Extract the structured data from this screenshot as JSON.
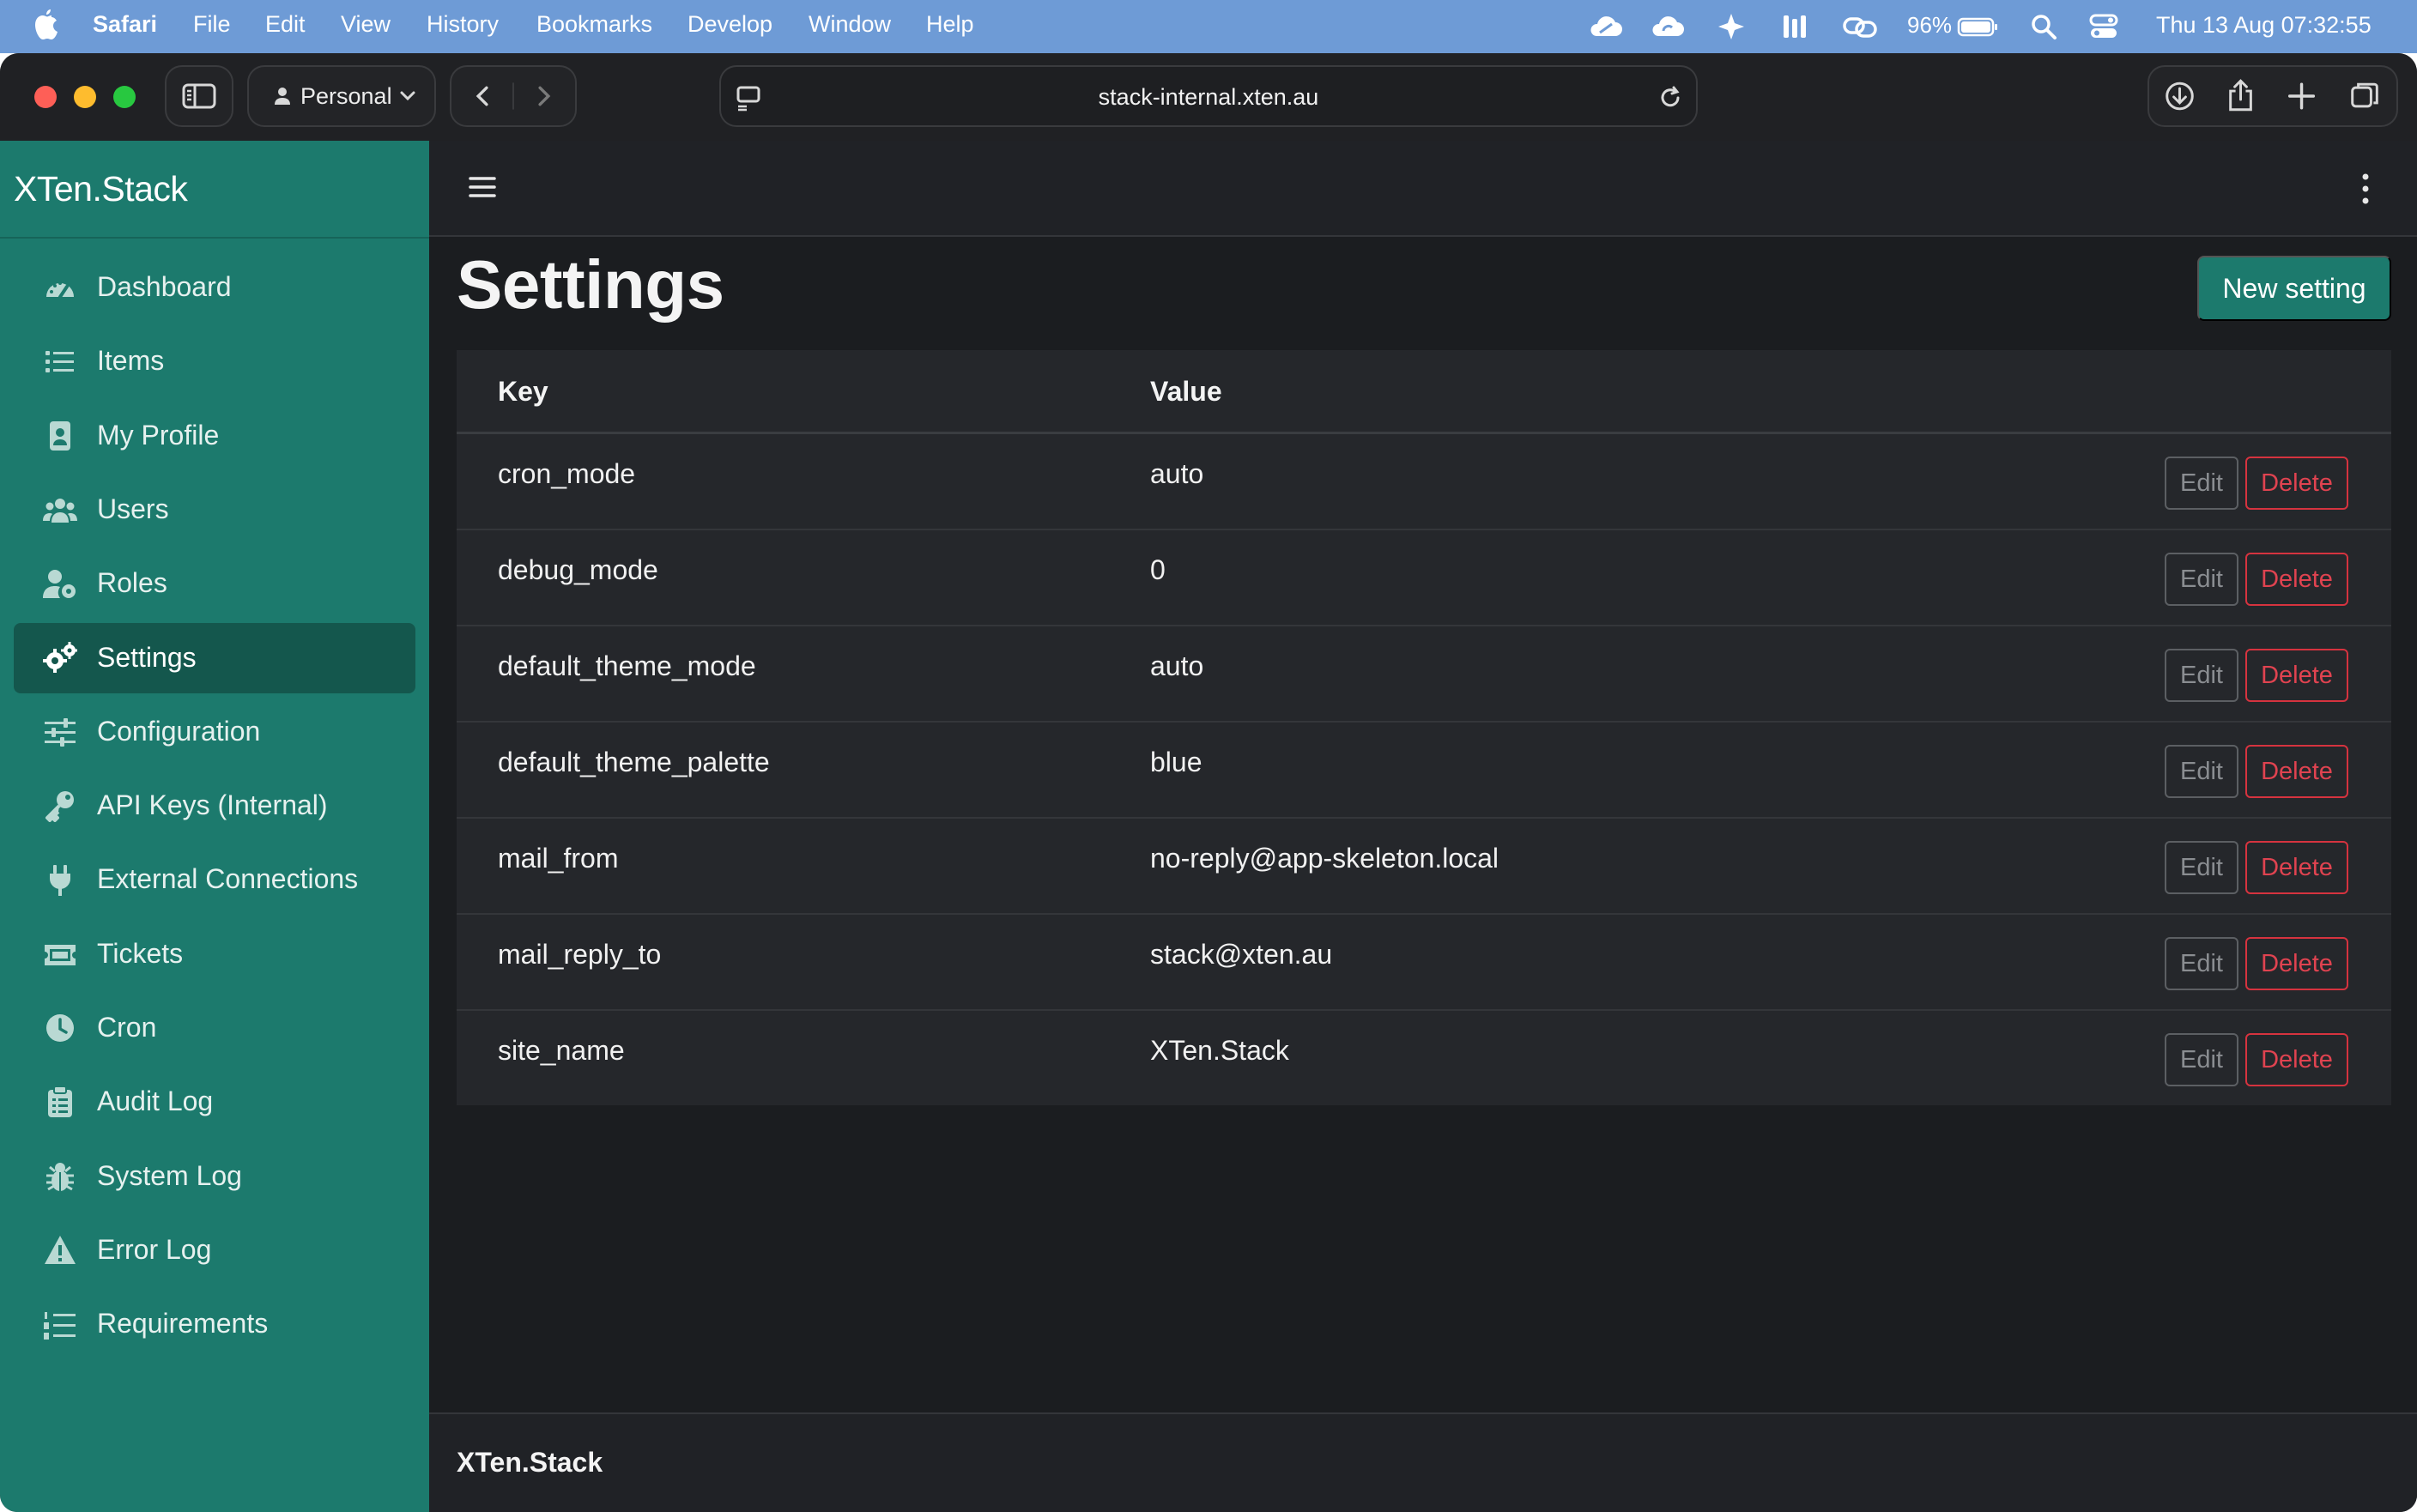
{
  "menubar": {
    "app_name": "Safari",
    "items": [
      "File",
      "Edit",
      "View",
      "History",
      "Bookmarks",
      "Develop",
      "Window",
      "Help"
    ],
    "battery": "96%",
    "datetime": "Thu 13 Aug  07:32:55",
    "bg_color": "#6e9bd6"
  },
  "browser": {
    "profile_label": "Personal",
    "url": "stack-internal.xten.au"
  },
  "sidebar": {
    "brand": "XTen.Stack",
    "bg_color": "#1c7a6d",
    "active_color": "#14574d",
    "items": [
      {
        "label": "Dashboard",
        "icon": "dashboard-icon"
      },
      {
        "label": "Items",
        "icon": "list-icon"
      },
      {
        "label": "My Profile",
        "icon": "id-badge-icon"
      },
      {
        "label": "Users",
        "icon": "users-icon"
      },
      {
        "label": "Roles",
        "icon": "user-gear-icon"
      },
      {
        "label": "Settings",
        "icon": "gears-icon",
        "active": true
      },
      {
        "label": "Configuration",
        "icon": "sliders-icon"
      },
      {
        "label": "API Keys (Internal)",
        "icon": "key-icon"
      },
      {
        "label": "External Connections",
        "icon": "plug-icon"
      },
      {
        "label": "Tickets",
        "icon": "ticket-icon"
      },
      {
        "label": "Cron",
        "icon": "clock-icon"
      },
      {
        "label": "Audit Log",
        "icon": "clipboard-icon"
      },
      {
        "label": "System Log",
        "icon": "bug-icon"
      },
      {
        "label": "Error Log",
        "icon": "warning-icon"
      },
      {
        "label": "Requirements",
        "icon": "list-ol-icon"
      }
    ]
  },
  "main": {
    "title": "Settings",
    "new_button": "New setting",
    "table": {
      "headers": {
        "key": "Key",
        "value": "Value"
      },
      "edit_label": "Edit",
      "delete_label": "Delete",
      "rows": [
        {
          "key": "cron_mode",
          "value": "auto"
        },
        {
          "key": "debug_mode",
          "value": "0"
        },
        {
          "key": "default_theme_mode",
          "value": "auto"
        },
        {
          "key": "default_theme_palette",
          "value": "blue"
        },
        {
          "key": "mail_from",
          "value": "no-reply@app-skeleton.local"
        },
        {
          "key": "mail_reply_to",
          "value": "stack@xten.au"
        },
        {
          "key": "site_name",
          "value": "XTen.Stack"
        }
      ]
    },
    "footer": "XTen.Stack"
  }
}
